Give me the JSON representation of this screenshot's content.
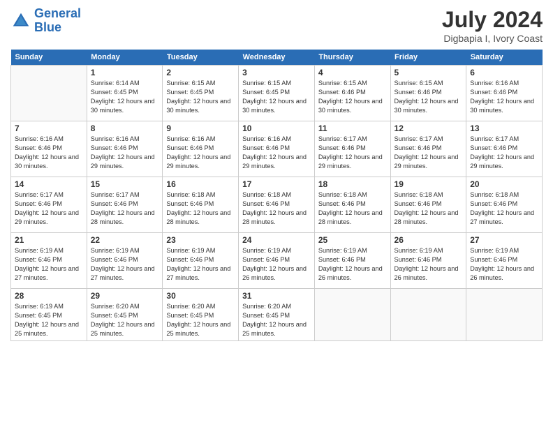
{
  "header": {
    "logo_line1": "General",
    "logo_line2": "Blue",
    "month_year": "July 2024",
    "location": "Digbapia I, Ivory Coast"
  },
  "days": [
    "Sunday",
    "Monday",
    "Tuesday",
    "Wednesday",
    "Thursday",
    "Friday",
    "Saturday"
  ],
  "weeks": [
    [
      {
        "date": "",
        "sunrise": "",
        "sunset": "",
        "daylight": ""
      },
      {
        "date": "1",
        "sunrise": "Sunrise: 6:14 AM",
        "sunset": "Sunset: 6:45 PM",
        "daylight": "Daylight: 12 hours and 30 minutes."
      },
      {
        "date": "2",
        "sunrise": "Sunrise: 6:15 AM",
        "sunset": "Sunset: 6:45 PM",
        "daylight": "Daylight: 12 hours and 30 minutes."
      },
      {
        "date": "3",
        "sunrise": "Sunrise: 6:15 AM",
        "sunset": "Sunset: 6:45 PM",
        "daylight": "Daylight: 12 hours and 30 minutes."
      },
      {
        "date": "4",
        "sunrise": "Sunrise: 6:15 AM",
        "sunset": "Sunset: 6:46 PM",
        "daylight": "Daylight: 12 hours and 30 minutes."
      },
      {
        "date": "5",
        "sunrise": "Sunrise: 6:15 AM",
        "sunset": "Sunset: 6:46 PM",
        "daylight": "Daylight: 12 hours and 30 minutes."
      },
      {
        "date": "6",
        "sunrise": "Sunrise: 6:16 AM",
        "sunset": "Sunset: 6:46 PM",
        "daylight": "Daylight: 12 hours and 30 minutes."
      }
    ],
    [
      {
        "date": "7",
        "sunrise": "Sunrise: 6:16 AM",
        "sunset": "Sunset: 6:46 PM",
        "daylight": "Daylight: 12 hours and 30 minutes."
      },
      {
        "date": "8",
        "sunrise": "Sunrise: 6:16 AM",
        "sunset": "Sunset: 6:46 PM",
        "daylight": "Daylight: 12 hours and 29 minutes."
      },
      {
        "date": "9",
        "sunrise": "Sunrise: 6:16 AM",
        "sunset": "Sunset: 6:46 PM",
        "daylight": "Daylight: 12 hours and 29 minutes."
      },
      {
        "date": "10",
        "sunrise": "Sunrise: 6:16 AM",
        "sunset": "Sunset: 6:46 PM",
        "daylight": "Daylight: 12 hours and 29 minutes."
      },
      {
        "date": "11",
        "sunrise": "Sunrise: 6:17 AM",
        "sunset": "Sunset: 6:46 PM",
        "daylight": "Daylight: 12 hours and 29 minutes."
      },
      {
        "date": "12",
        "sunrise": "Sunrise: 6:17 AM",
        "sunset": "Sunset: 6:46 PM",
        "daylight": "Daylight: 12 hours and 29 minutes."
      },
      {
        "date": "13",
        "sunrise": "Sunrise: 6:17 AM",
        "sunset": "Sunset: 6:46 PM",
        "daylight": "Daylight: 12 hours and 29 minutes."
      }
    ],
    [
      {
        "date": "14",
        "sunrise": "Sunrise: 6:17 AM",
        "sunset": "Sunset: 6:46 PM",
        "daylight": "Daylight: 12 hours and 29 minutes."
      },
      {
        "date": "15",
        "sunrise": "Sunrise: 6:17 AM",
        "sunset": "Sunset: 6:46 PM",
        "daylight": "Daylight: 12 hours and 28 minutes."
      },
      {
        "date": "16",
        "sunrise": "Sunrise: 6:18 AM",
        "sunset": "Sunset: 6:46 PM",
        "daylight": "Daylight: 12 hours and 28 minutes."
      },
      {
        "date": "17",
        "sunrise": "Sunrise: 6:18 AM",
        "sunset": "Sunset: 6:46 PM",
        "daylight": "Daylight: 12 hours and 28 minutes."
      },
      {
        "date": "18",
        "sunrise": "Sunrise: 6:18 AM",
        "sunset": "Sunset: 6:46 PM",
        "daylight": "Daylight: 12 hours and 28 minutes."
      },
      {
        "date": "19",
        "sunrise": "Sunrise: 6:18 AM",
        "sunset": "Sunset: 6:46 PM",
        "daylight": "Daylight: 12 hours and 28 minutes."
      },
      {
        "date": "20",
        "sunrise": "Sunrise: 6:18 AM",
        "sunset": "Sunset: 6:46 PM",
        "daylight": "Daylight: 12 hours and 27 minutes."
      }
    ],
    [
      {
        "date": "21",
        "sunrise": "Sunrise: 6:19 AM",
        "sunset": "Sunset: 6:46 PM",
        "daylight": "Daylight: 12 hours and 27 minutes."
      },
      {
        "date": "22",
        "sunrise": "Sunrise: 6:19 AM",
        "sunset": "Sunset: 6:46 PM",
        "daylight": "Daylight: 12 hours and 27 minutes."
      },
      {
        "date": "23",
        "sunrise": "Sunrise: 6:19 AM",
        "sunset": "Sunset: 6:46 PM",
        "daylight": "Daylight: 12 hours and 27 minutes."
      },
      {
        "date": "24",
        "sunrise": "Sunrise: 6:19 AM",
        "sunset": "Sunset: 6:46 PM",
        "daylight": "Daylight: 12 hours and 26 minutes."
      },
      {
        "date": "25",
        "sunrise": "Sunrise: 6:19 AM",
        "sunset": "Sunset: 6:46 PM",
        "daylight": "Daylight: 12 hours and 26 minutes."
      },
      {
        "date": "26",
        "sunrise": "Sunrise: 6:19 AM",
        "sunset": "Sunset: 6:46 PM",
        "daylight": "Daylight: 12 hours and 26 minutes."
      },
      {
        "date": "27",
        "sunrise": "Sunrise: 6:19 AM",
        "sunset": "Sunset: 6:46 PM",
        "daylight": "Daylight: 12 hours and 26 minutes."
      }
    ],
    [
      {
        "date": "28",
        "sunrise": "Sunrise: 6:19 AM",
        "sunset": "Sunset: 6:45 PM",
        "daylight": "Daylight: 12 hours and 25 minutes."
      },
      {
        "date": "29",
        "sunrise": "Sunrise: 6:20 AM",
        "sunset": "Sunset: 6:45 PM",
        "daylight": "Daylight: 12 hours and 25 minutes."
      },
      {
        "date": "30",
        "sunrise": "Sunrise: 6:20 AM",
        "sunset": "Sunset: 6:45 PM",
        "daylight": "Daylight: 12 hours and 25 minutes."
      },
      {
        "date": "31",
        "sunrise": "Sunrise: 6:20 AM",
        "sunset": "Sunset: 6:45 PM",
        "daylight": "Daylight: 12 hours and 25 minutes."
      },
      {
        "date": "",
        "sunrise": "",
        "sunset": "",
        "daylight": ""
      },
      {
        "date": "",
        "sunrise": "",
        "sunset": "",
        "daylight": ""
      },
      {
        "date": "",
        "sunrise": "",
        "sunset": "",
        "daylight": ""
      }
    ]
  ]
}
